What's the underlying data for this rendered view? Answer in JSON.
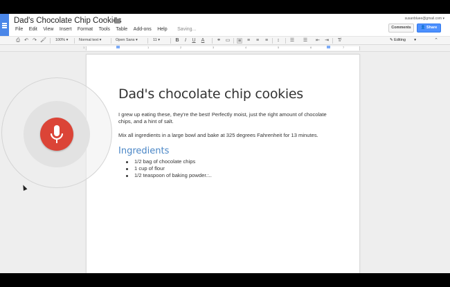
{
  "header": {
    "title": "Dad's Chocolate Chip Cookies",
    "user_email": "susanbluee@gmail.com",
    "comments_label": "Comments",
    "share_label": "Share"
  },
  "menu": {
    "items": [
      "File",
      "Edit",
      "View",
      "Insert",
      "Format",
      "Tools",
      "Table",
      "Add-ons",
      "Help"
    ],
    "saving_status": "Saving..."
  },
  "toolbar": {
    "zoom": "100%",
    "style": "Normal text",
    "font": "Open Sans",
    "size": "11",
    "mode": "Editing"
  },
  "ruler": {
    "numbers": [
      "1",
      "1",
      "2",
      "3",
      "4",
      "5",
      "6",
      "7"
    ]
  },
  "document": {
    "heading": "Dad's chocolate chip cookies",
    "paragraph1": "I grew up eating these, they're the best!  Perfectly moist, just the right amount of chocolate chips, and a hint of salt.",
    "paragraph2": "Mix all ingredients in a large bowl and bake at 325 degrees Fahrenheit for 13 minutes.",
    "ingredients_heading": "Ingredients",
    "ingredients": [
      "1/2 bag of chocolate chips",
      "1 cup of flour",
      "1/2 teaspoon of baking powder.:.."
    ]
  },
  "colors": {
    "accent": "#4a86e8",
    "share": "#4d90fe",
    "mic": "#db4437",
    "heading_blue": "#4a86c6"
  },
  "icons": {
    "mic": "microphone-icon",
    "star": "star-icon",
    "folder": "folder-icon"
  }
}
